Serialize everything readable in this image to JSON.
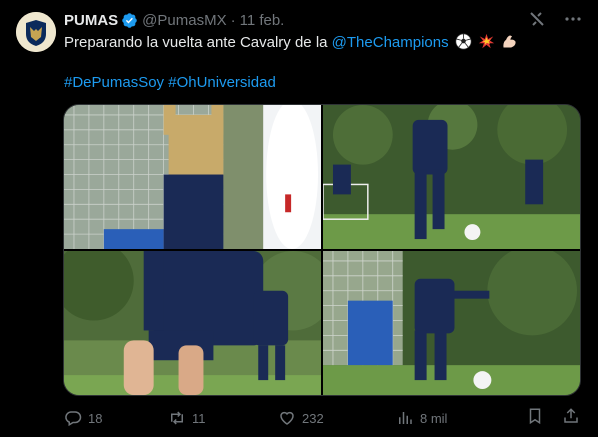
{
  "tweet": {
    "author_name": "PUMAS",
    "handle": "@PumasMX",
    "separator": "·",
    "date": "11 feb.",
    "text_prefix": "Preparando la vuelta ante Cavalry de la ",
    "mention": "@TheChampions",
    "emojis": [
      "soccer-ball-icon",
      "collision-icon",
      "flexed-biceps-icon"
    ],
    "hashtags": [
      "#DePumasSoy",
      "#OhUniversidad"
    ]
  },
  "media": {
    "photos": [
      {
        "name": "photo-goalkeeper",
        "alt": "goalkeeper training"
      },
      {
        "name": "photo-player-running",
        "alt": "player running with ball"
      },
      {
        "name": "photo-player-closeup",
        "alt": "player close-up"
      },
      {
        "name": "photo-player-kick",
        "alt": "player kicking ball"
      }
    ]
  },
  "actions": {
    "replies": "18",
    "retweets": "11",
    "likes": "232",
    "views": "8 mil"
  },
  "colors": {
    "background": "#000000",
    "link": "#1d9bf0",
    "muted": "#71767b",
    "text": "#e7e9ea"
  }
}
